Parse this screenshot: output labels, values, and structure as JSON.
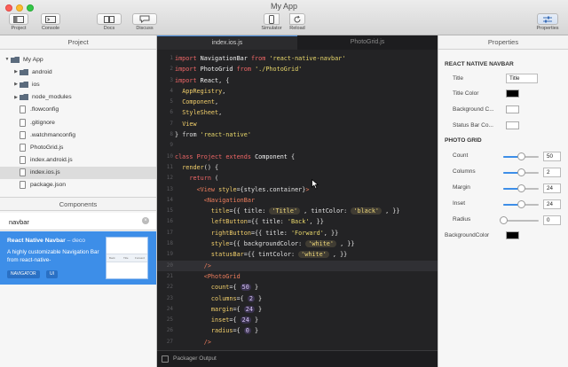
{
  "app": {
    "title": "My App"
  },
  "toolbar": {
    "project": "Project",
    "console": "Console",
    "docs": "Docs",
    "discuss": "Discuss",
    "simulator": "Simulator",
    "reload": "Reload",
    "properties": "Properties"
  },
  "left": {
    "project_head": "Project",
    "tree": [
      {
        "label": "My App",
        "kind": "root"
      },
      {
        "label": "android",
        "kind": "folder"
      },
      {
        "label": "ios",
        "kind": "folder"
      },
      {
        "label": "node_modules",
        "kind": "folder"
      },
      {
        "label": ".flowconfig",
        "kind": "file"
      },
      {
        "label": ".gitignore",
        "kind": "file"
      },
      {
        "label": ".watchmanconfig",
        "kind": "file"
      },
      {
        "label": "PhotoGrid.js",
        "kind": "file"
      },
      {
        "label": "index.android.js",
        "kind": "file"
      },
      {
        "label": "index.ios.js",
        "kind": "file",
        "selected": true
      },
      {
        "label": "package.json",
        "kind": "file"
      }
    ],
    "components_head": "Components",
    "search_value": "navbar",
    "result": {
      "title": "React Native Navbar",
      "author": "– deco",
      "description": "A highly customizable Navigation Bar from react-native-",
      "badges": [
        "NAVIGATOR",
        "UI"
      ],
      "thumb_labels": [
        "Back",
        "Title",
        "Forward"
      ]
    }
  },
  "editor": {
    "tabs": [
      {
        "label": "index.ios.js",
        "active": true
      },
      {
        "label": "PhotoGrid.js",
        "active": false
      }
    ],
    "bottom_label": "Packager Output"
  },
  "properties": {
    "head": "Properties",
    "navbar_section": "REACT NATIVE NAVBAR",
    "navbar": [
      {
        "label": "Title",
        "type": "text",
        "value": "Title"
      },
      {
        "label": "Title Color",
        "type": "color",
        "value": "#000000"
      },
      {
        "label": "Background C...",
        "type": "color",
        "value": "#ffffff"
      },
      {
        "label": "Status Bar Co...",
        "type": "color",
        "value": "#ffffff"
      }
    ],
    "grid_section": "PHOTO GRID",
    "grid": [
      {
        "label": "Count",
        "value": "50",
        "fraction": 0.5
      },
      {
        "label": "Columns",
        "value": "2",
        "fraction": 0.5
      },
      {
        "label": "Margin",
        "value": "24",
        "fraction": 0.5
      },
      {
        "label": "Inset",
        "value": "24",
        "fraction": 0.5
      },
      {
        "label": "Radius",
        "value": "0",
        "fraction": 0.0
      }
    ],
    "bg_label": "BackgroundColor",
    "bg_value": "#000000"
  }
}
